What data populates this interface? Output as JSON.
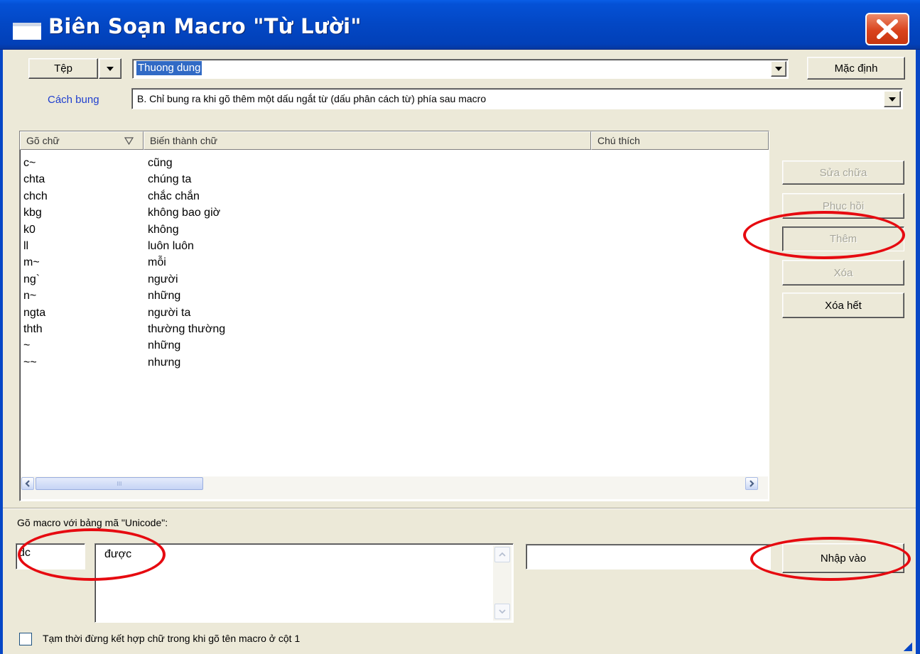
{
  "window": {
    "title": "Biên Soạn Macro \"Từ Lười\""
  },
  "toolbar": {
    "file_button": "Tệp",
    "file_value": "Thuong dung",
    "default_button": "Mặc định",
    "expand_label": "Cách bung",
    "expand_value": "B. Chỉ bung ra khi gõ thêm một dấu ngắt từ (dấu phân cách từ) phía sau macro"
  },
  "table": {
    "columns": [
      "Gõ chữ",
      "Biến thành chữ",
      "Chú thích"
    ],
    "rows": [
      {
        "key": "c~",
        "value": "cũng",
        "note": ""
      },
      {
        "key": "chta",
        "value": "chúng ta",
        "note": ""
      },
      {
        "key": "chch",
        "value": "chắc chắn",
        "note": ""
      },
      {
        "key": "kbg",
        "value": "không bao giờ",
        "note": ""
      },
      {
        "key": "k0",
        "value": "không",
        "note": ""
      },
      {
        "key": "ll",
        "value": "luôn luôn",
        "note": ""
      },
      {
        "key": "m~",
        "value": "mỗi",
        "note": ""
      },
      {
        "key": "ng`",
        "value": "người",
        "note": ""
      },
      {
        "key": "n~",
        "value": "những",
        "note": ""
      },
      {
        "key": "ngta",
        "value": "người ta",
        "note": ""
      },
      {
        "key": "thth",
        "value": "thường thường",
        "note": ""
      },
      {
        "key": "~",
        "value": "những",
        "note": ""
      },
      {
        "key": "~~",
        "value": "nhưng",
        "note": ""
      }
    ],
    "hscroll_thumb_glyph": "III"
  },
  "side_buttons": {
    "edit": "Sửa chữa",
    "restore": "Phục hồi",
    "add": "Thêm",
    "delete": "Xóa",
    "delete_all": "Xóa hết"
  },
  "editor": {
    "encoding_label": "Gõ macro với bảng mã \"Unicode\":",
    "macro_value": "dc",
    "expansion_value": "được",
    "comment_value": "",
    "import_button": "Nhập vào",
    "checkbox_label": "Tạm thời đừng kết hợp chữ trong khi gõ tên macro ở cột 1",
    "checkbox_checked": false
  },
  "colors": {
    "titlebar": "#0347c4",
    "dialog_bg": "#ece9d8",
    "selection": "#316ac5",
    "link_label": "#1f3fcf",
    "annotation": "#e60a10",
    "close_button": "#d9431c"
  }
}
